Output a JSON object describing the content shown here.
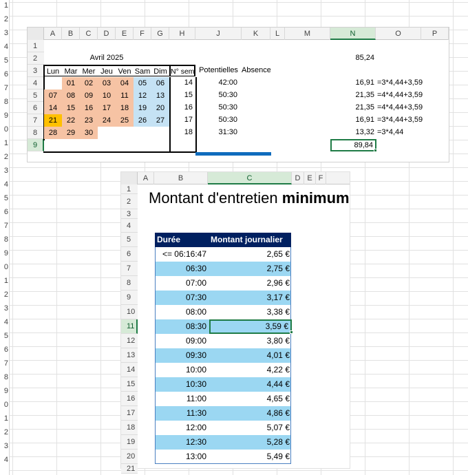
{
  "left_row_numbers": [
    "1",
    "2",
    "3",
    "4",
    "5",
    "6",
    "7",
    "8",
    "9",
    "0",
    "1",
    "2",
    "3",
    "4",
    "5",
    "6",
    "7",
    "8",
    "9",
    "0",
    "1",
    "2",
    "3",
    "4",
    "5",
    "6",
    "7",
    "8",
    "9",
    "0",
    "1",
    "2",
    "3",
    "4"
  ],
  "sheet1": {
    "columns": [
      "A",
      "B",
      "C",
      "D",
      "E",
      "F",
      "G",
      "H",
      "J",
      "K",
      "L",
      "M",
      "N",
      "O",
      "P"
    ],
    "rows": [
      "1",
      "2",
      "3",
      "4",
      "5",
      "6",
      "7",
      "8",
      "9"
    ],
    "month_title": "Avril 2025",
    "day_headers": [
      "Lun",
      "Mar",
      "Mer",
      "Jeu",
      "Ven",
      "Sam",
      "Dim"
    ],
    "week_header": "N° sem",
    "pot_header": "Potentielles",
    "abs_header": "Absence",
    "weeks": [
      {
        "days": [
          "",
          "01",
          "02",
          "03",
          "04",
          "05",
          "06"
        ],
        "week": "14",
        "pot": "42:00",
        "n": "16,91",
        "o": "=3*4,44+3,59"
      },
      {
        "days": [
          "07",
          "08",
          "09",
          "10",
          "11",
          "12",
          "13"
        ],
        "week": "15",
        "pot": "50:30",
        "n": "21,35",
        "o": "=4*4,44+3,59"
      },
      {
        "days": [
          "14",
          "15",
          "16",
          "17",
          "18",
          "19",
          "20"
        ],
        "week": "16",
        "pot": "50:30",
        "n": "21,35",
        "o": "=4*4,44+3,59"
      },
      {
        "days": [
          "21",
          "22",
          "23",
          "24",
          "25",
          "26",
          "27"
        ],
        "week": "17",
        "pot": "50:30",
        "n": "16,91",
        "o": "=3*4,44+3,59"
      },
      {
        "days": [
          "28",
          "29",
          "30",
          "",
          "",
          "",
          ""
        ],
        "week": "18",
        "pot": "31:30",
        "n": "13,32",
        "o": "=3*4,44"
      }
    ],
    "n2": "85,24",
    "n9": "89,84"
  },
  "sheet2": {
    "columns": [
      "A",
      "B",
      "C",
      "D",
      "E",
      "F"
    ],
    "title_regular": "Montant d'entretien ",
    "title_bold": "minimum",
    "header_duree": "Durée",
    "header_montant": "Montant journalier",
    "row_numbers": [
      "1",
      "2",
      "3",
      "4",
      "5",
      "6",
      "7",
      "8",
      "9",
      "10",
      "11",
      "12",
      "13",
      "14",
      "15",
      "16",
      "17",
      "18",
      "19",
      "20",
      "21"
    ],
    "rows": [
      {
        "d": "<= 06:16:47",
        "m": "2,65 €"
      },
      {
        "d": "06:30",
        "m": "2,75 €"
      },
      {
        "d": "07:00",
        "m": "2,96 €"
      },
      {
        "d": "07:30",
        "m": "3,17 €"
      },
      {
        "d": "08:00",
        "m": "3,38 €"
      },
      {
        "d": "08:30",
        "m": "3,59 €"
      },
      {
        "d": "09:00",
        "m": "3,80 €"
      },
      {
        "d": "09:30",
        "m": "4,01 €"
      },
      {
        "d": "10:00",
        "m": "4,22 €"
      },
      {
        "d": "10:30",
        "m": "4,44 €"
      },
      {
        "d": "11:00",
        "m": "4,65 €"
      },
      {
        "d": "11:30",
        "m": "4,86 €"
      },
      {
        "d": "12:00",
        "m": "5,07 €"
      },
      {
        "d": "12:30",
        "m": "5,28 €"
      },
      {
        "d": "13:00",
        "m": "5,49 €"
      }
    ]
  },
  "colors": {
    "salmon": "#f6c3a4",
    "blue": "#c5e2f4",
    "orange": "#ffc000",
    "header_navy": "#002060",
    "row_band": "#9bd7f2",
    "excel_green": "#1e7b45"
  }
}
